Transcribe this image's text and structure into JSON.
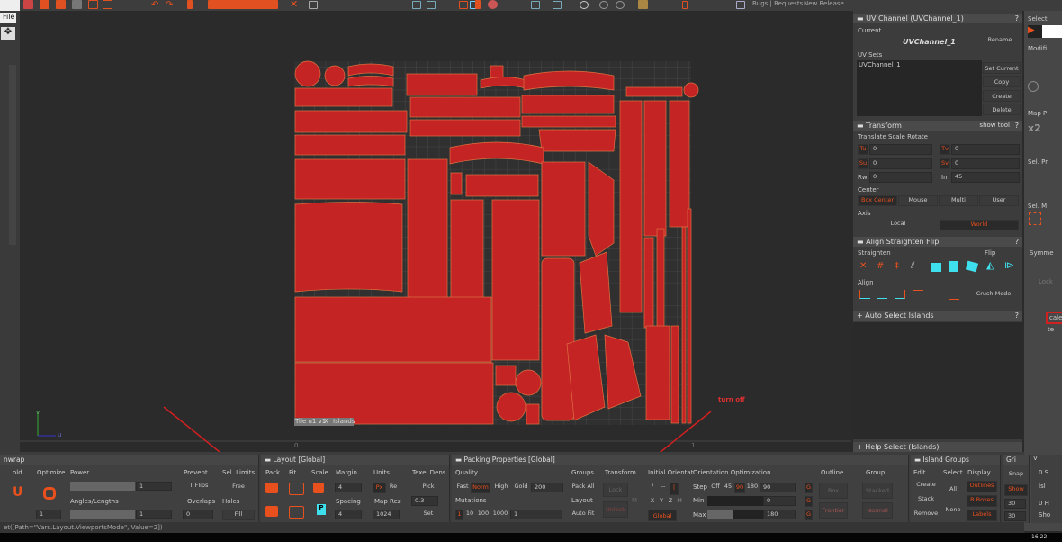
{
  "menu": {
    "file": "File"
  },
  "toolbar": {
    "links": "Bugs | Requests",
    "release": "New Release"
  },
  "viewport": {
    "tile_label": "Tile u1 v1",
    "tile_close": "X",
    "tile_mode": "Islands",
    "axis_u": "u",
    "axis_v": "v",
    "ruler_0": "0",
    "ruler_1": "1",
    "annotation": "turn off",
    "island_color": "#c42424"
  },
  "uv_channel": {
    "title": "UV Channel (UVChannel_1)",
    "help": "?",
    "current_label": "Current",
    "current_value": "UVChannel_1",
    "rename": "Rename",
    "uv_sets_label": "UV Sets",
    "sets": [
      "UVChannel_1"
    ],
    "set_current": "Set Current",
    "copy": "Copy",
    "create": "Create",
    "delete": "Delete"
  },
  "transform": {
    "title": "Transform",
    "show_tool": "show tool",
    "help": "?",
    "subtitle": "Translate Scale Rotate",
    "tu": "Tu",
    "tu_val": "0",
    "tv": "Tv",
    "tv_val": "0",
    "su": "Su",
    "su_val": "0",
    "sv": "Sv",
    "sv_val": "0",
    "rw": "Rw",
    "rw_val": "0",
    "in": "In",
    "in_val": "45",
    "center_label": "Center",
    "centers": [
      "Box Center",
      "Mouse",
      "Multi",
      "User"
    ],
    "axis_label": "Axis",
    "local": "Local",
    "world": "World"
  },
  "align": {
    "title": "Align Straighten Flip",
    "help": "?",
    "straighten": "Straighten",
    "flip": "Flip",
    "align": "Align",
    "crush": "Crush Mode"
  },
  "auto_select": {
    "title": "Auto Select Islands",
    "help": "?"
  },
  "help_select": {
    "title": "Help Select (Islands)"
  },
  "far_right": {
    "select": "Select",
    "modify": "Modifi",
    "map": "Map P",
    "x2": "x2",
    "sel_pr": "Sel. Pr",
    "sel_m": "Sel. M",
    "symm": "Symme",
    "lock": "Lock",
    "scale": "cale",
    "te": "te"
  },
  "unwrap": {
    "title": "nwrap",
    "fold": "old",
    "optimize": "Optimize",
    "power": "Power",
    "power_val": "1",
    "angles": "Angles/Lengths",
    "angles_val": "1",
    "iter_val": "1",
    "prevent": "Prevent",
    "tflips": "T Flips",
    "overlaps": "Overlaps",
    "overlaps_val": "0",
    "sel_limits": "Sel. Limits",
    "free": "Free",
    "holes": "Holes",
    "fill": "Fill"
  },
  "layout": {
    "title": "Layout [Global]",
    "help": "?",
    "pack": "Pack",
    "fit": "Fit",
    "scale": "Scale",
    "margin": "Margin",
    "margin_val": "4",
    "spacing": "Spacing",
    "spacing_val": "4",
    "units": "Units",
    "px": "Px",
    "re": "Re",
    "map_rez": "Map Rez",
    "map_rez_val": "1024",
    "texel": "Texel Dens.",
    "pick": "Pick",
    "texel_val": "0.3",
    "set": "Set",
    "p": "P"
  },
  "packing": {
    "title": "Packing Properties [Global]",
    "help": "?",
    "quality": "Quality",
    "qualities": [
      "Fast",
      "Norm",
      "High",
      "Gold"
    ],
    "quality_val": "200",
    "mutations": "Mutations",
    "mutation_opts": [
      "1",
      "10",
      "100",
      "1000"
    ],
    "mutation_val": "1",
    "groups": "Groups",
    "pack_all": "Pack All",
    "layout": "Layout",
    "auto_fit": "Auto Fit",
    "transform": "Transform",
    "lock": "Lock",
    "unlock": "Unlock",
    "m": "M",
    "initial": "Initial Orientat",
    "init_opts": [
      "/",
      "--",
      "|"
    ],
    "xyz": [
      "X",
      "Y",
      "Z",
      "M"
    ],
    "global": "Global",
    "orient_opt": "Orientation Optimization",
    "step": "Step",
    "steps": [
      "Off",
      "45",
      "90",
      "180"
    ],
    "step_val": "90",
    "min": "Min",
    "min_val": "0",
    "max": "Max",
    "max_val": "180",
    "g": "G",
    "outline": "Outline",
    "box": "Box",
    "frontier": "Frontier",
    "group": "Group",
    "stacked": "Stacked",
    "normal": "Normal"
  },
  "island_groups": {
    "title": "Island Groups",
    "help": "?",
    "edit": "Edit",
    "select": "Select",
    "display": "Display",
    "create": "Create",
    "stack": "Stack",
    "remove": "Remove",
    "all": "All",
    "none": "None",
    "outlines": "Outlines",
    "bboxes": "B.Boxes",
    "labels": "Labels"
  },
  "grid": {
    "title": "Gri",
    "help": "?",
    "snap": "Snap",
    "show": "Show",
    "v1": "30",
    "v2": "30"
  },
  "extra": {
    "title": "V",
    "a": "0 S",
    "b": "Isl",
    "c": "0 H",
    "d": "Sho"
  },
  "status": {
    "text": "et([Path=\"Vars.Layout.ViewportsMode\", Value=2])"
  },
  "taskbar": {
    "time": "16:22"
  }
}
